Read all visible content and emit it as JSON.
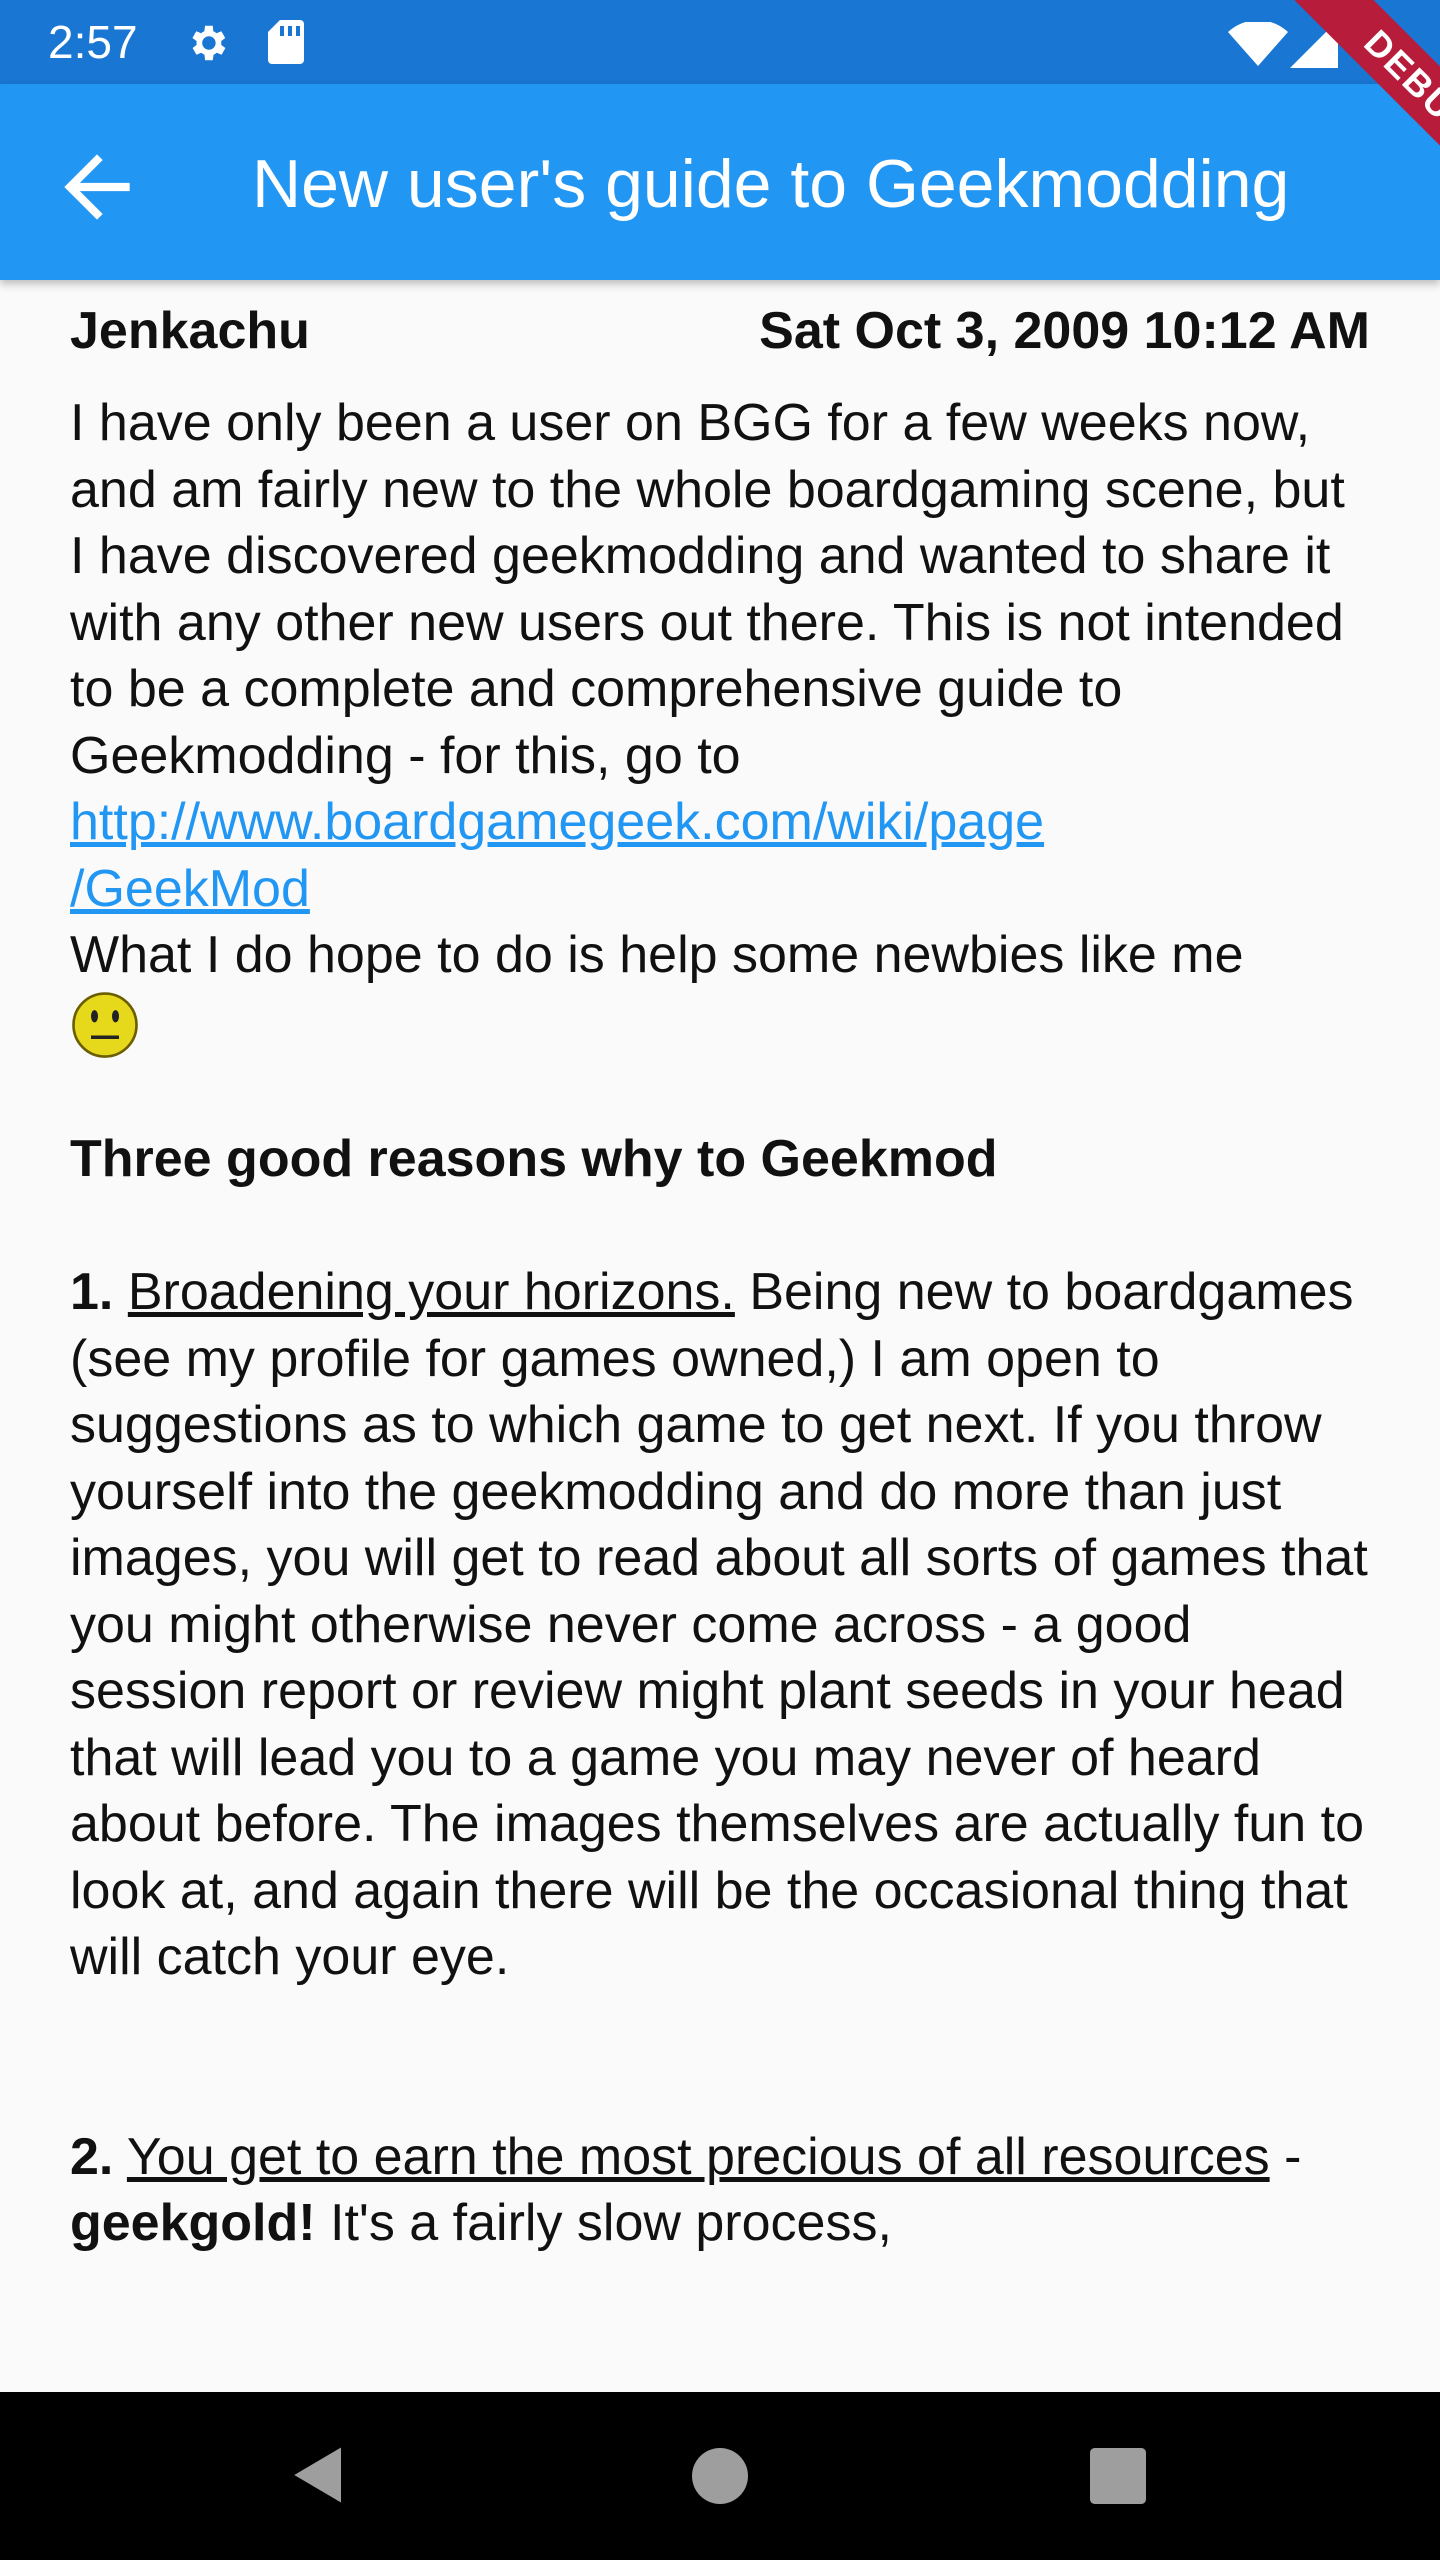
{
  "status_bar": {
    "time": "2:57",
    "icons": [
      "gear-icon",
      "sd-card-icon",
      "wifi-icon",
      "signal-icon",
      "battery-icon"
    ]
  },
  "app_bar": {
    "title": "New user's guide to Geekmodding",
    "back_icon": "arrow-left-icon",
    "debug_label": "DEBUG"
  },
  "post": {
    "author": "Jenkachu",
    "timestamp": "Sat Oct 3, 2009 10:12 AM",
    "intro": "I have only been a user on BGG for a few weeks now, and am fairly new to the whole boardgaming scene, but I have discovered geekmodding and wanted to share it with any other new users out there. This is not intended to be a complete and comprehensive guide to Geekmodding - for this, go to",
    "link_line1": "http://www.boardgamegeek.com/wiki/page",
    "link_line2": "/GeekMod",
    "hope": "What I do hope to do is help some newbies like me",
    "heading": "Three good reasons why to Geekmod",
    "r1_num": "1.",
    "r1_title": "Broadening your horizons.",
    "r1_text": " Being new to boardgames (see my profile for games owned,) I am open to suggestions as to which game to get next. If you throw yourself into the geekmodding and do more than just images, you will get to read about all sorts of games that you might otherwise never come across - a good session report or review might plant seeds in your head that will lead you to a game you may never of heard about before. The images themselves are actually fun to look at, and again there will be the occasional thing that will catch your eye.",
    "r2_num": "2.",
    "r2_title": "You get to earn the most precious of all resources",
    "r2_dash": " - ",
    "r2_bold": "geekgold!",
    "r2_text": " It's a fairly slow process,"
  },
  "colors": {
    "status_bar": "#1976d2",
    "app_bar": "#2196f3",
    "link": "#2196f3",
    "debug_ribbon": "#b71c3a",
    "nav_bar": "#000000"
  },
  "nav_bar": {
    "icons": [
      "nav-back-icon",
      "nav-home-icon",
      "nav-recent-icon"
    ]
  }
}
